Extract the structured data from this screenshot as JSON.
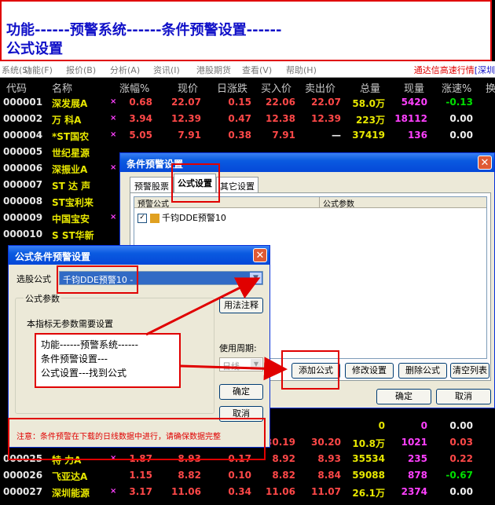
{
  "banner": {
    "line1": "功能------预警系统------条件预警设置------",
    "line2": "公式设置"
  },
  "menu": {
    "items": [
      "系统(S)",
      "功能(F)",
      "报价(B)",
      "分析(A)",
      "资讯(I)",
      "港股期货",
      "查看(V)",
      "帮助(H)"
    ],
    "right_a": "通达信高速行情",
    "right_b": "[深圳"
  },
  "table": {
    "headers": [
      "代码",
      "名称",
      "涨幅%",
      "现价",
      "日涨跌",
      "买入价",
      "卖出价",
      "总量",
      "现量",
      "涨速%",
      "换"
    ],
    "rows": [
      {
        "code": "000001",
        "name": "深发展A",
        "mark": "×",
        "chg": "0.68",
        "price": "22.07",
        "diff": "0.15",
        "bid": "22.06",
        "ask": "22.07",
        "vol": "58.0万",
        "cur": "5420",
        "speed": "-0.13"
      },
      {
        "code": "000002",
        "name": "万  科A",
        "mark": "×",
        "chg": "3.94",
        "price": "12.39",
        "diff": "0.47",
        "bid": "12.38",
        "ask": "12.39",
        "vol": "223万",
        "cur": "18112",
        "speed": "0.00"
      },
      {
        "code": "000004",
        "name": "*ST国农",
        "mark": "×",
        "chg": "5.05",
        "price": "7.91",
        "diff": "0.38",
        "bid": "7.91",
        "ask": "—",
        "vol": "37419",
        "cur": "136",
        "speed": "0.00"
      },
      {
        "code": "000005",
        "name": "世纪星源",
        "mark": "",
        "chg": "",
        "price": "",
        "diff": "",
        "bid": "",
        "ask": "",
        "vol": "",
        "cur": "",
        "speed": ""
      },
      {
        "code": "000006",
        "name": "深振业A",
        "mark": "×",
        "chg": "",
        "price": "",
        "diff": "",
        "bid": "",
        "ask": "",
        "vol": "",
        "cur": "",
        "speed": ""
      },
      {
        "code": "000007",
        "name": "ST 达  声",
        "mark": "",
        "chg": "",
        "price": "",
        "diff": "",
        "bid": "",
        "ask": "",
        "vol": "",
        "cur": "",
        "speed": ""
      },
      {
        "code": "000008",
        "name": "ST宝利来",
        "mark": "",
        "chg": "",
        "price": "",
        "diff": "",
        "bid": "",
        "ask": "",
        "vol": "",
        "cur": "",
        "speed": ""
      },
      {
        "code": "000009",
        "name": "中国宝安",
        "mark": "×",
        "chg": "",
        "price": "",
        "diff": "",
        "bid": "",
        "ask": "",
        "vol": "",
        "cur": "",
        "speed": ""
      },
      {
        "code": "000010",
        "name": "S ST华新",
        "mark": "",
        "chg": "",
        "price": "",
        "diff": "",
        "bid": "",
        "ask": "",
        "vol": "",
        "cur": "",
        "speed": ""
      }
    ],
    "bottom_rows": [
      {
        "code": "",
        "name": "",
        "mark": "",
        "chg": "",
        "price": "",
        "diff": "",
        "bid": "",
        "ask": "",
        "vol": "0",
        "cur": "0",
        "speed": "0.00"
      },
      {
        "code": "",
        "name": "",
        "mark": "",
        "chg": "",
        "price": "",
        "diff": "",
        "bid": "30.19",
        "ask": "30.20",
        "vol": "10.8万",
        "cur": "1021",
        "speed": "0.03"
      },
      {
        "code": "000025",
        "name": "特  力A",
        "mark": "×",
        "chg": "1.87",
        "price": "8.93",
        "diff": "0.17",
        "bid": "8.92",
        "ask": "8.93",
        "vol": "35534",
        "cur": "235",
        "speed": "0.22"
      },
      {
        "code": "000026",
        "name": "飞亚达A",
        "mark": "",
        "chg": "1.15",
        "price": "8.82",
        "diff": "0.10",
        "bid": "8.82",
        "ask": "8.84",
        "vol": "59088",
        "cur": "878",
        "speed": "-0.67"
      },
      {
        "code": "000027",
        "name": "深圳能源",
        "mark": "×",
        "chg": "3.17",
        "price": "11.06",
        "diff": "0.34",
        "bid": "11.06",
        "ask": "11.07",
        "vol": "26.1万",
        "cur": "2374",
        "speed": "0.00"
      }
    ]
  },
  "dialog_main": {
    "title": "条件预警设置",
    "tabs": [
      "预警股票",
      "公式设置",
      "其它设置"
    ],
    "col_formula": "预警公式",
    "col_params": "公式参数",
    "item": "千钧DDE预警10",
    "buttons": {
      "add": "添加公式",
      "modify": "修改设置",
      "delete": "删除公式",
      "clear": "清空列表",
      "ok": "确定",
      "cancel": "取消"
    }
  },
  "dialog_formula": {
    "title": "公式条件预警设置",
    "select_label": "选股公式",
    "select_value": "千钧DDE预警10 -",
    "group_label": "公式参数",
    "no_params": "本指标无参数需要设置",
    "btn_usage": "用法注释",
    "period_label": "使用周期:",
    "period_value": "日线",
    "btn_ok": "确定",
    "btn_cancel": "取消",
    "note": "注意：条件预警在下载的日线数据中进行，请确保数据完整"
  },
  "annotation": {
    "line1": "功能------预警系统------",
    "line2": "条件预警设置---",
    "line3": "公式设置---找到公式"
  },
  "colors": {
    "accent_red": "#e00000",
    "title_blue": "#1010c8",
    "row_yellow": "#e8e800",
    "up_red": "#ff4848",
    "down_green": "#00e000"
  }
}
